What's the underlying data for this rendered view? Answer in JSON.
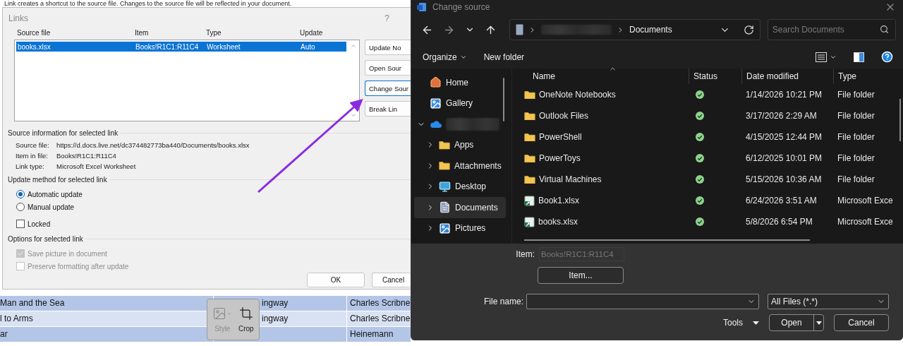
{
  "document": {
    "top_text": "Link creates a shortcut to the source file. Changes to the source file will be reflected in your document.",
    "table_rows": [
      {
        "cells": [
          "Man and the Sea",
          "ingway",
          "Charles Scribne"
        ]
      },
      {
        "cells": [
          "l to Arms",
          "ingway",
          "Charles Scribne"
        ]
      },
      {
        "cells": [
          "ar",
          null,
          "Heinemann"
        ]
      }
    ]
  },
  "links_dialog": {
    "title": "Links",
    "help": "?",
    "columns": [
      "Source file",
      "Item",
      "Type",
      "Update"
    ],
    "rows": [
      {
        "cells": [
          "books.xlsx",
          "Books!R1C1:R11C4",
          "Worksheet",
          "Auto"
        ],
        "selected": true
      }
    ],
    "side_buttons": [
      {
        "label": "Update No",
        "focused": false
      },
      {
        "label": "Open Sour",
        "focused": false
      },
      {
        "label": "Change Sour",
        "focused": true
      },
      {
        "label": "Break Lin",
        "focused": false
      }
    ],
    "source_info": {
      "heading": "Source information for selected link",
      "fields": [
        {
          "label": "Source file:",
          "value": "https://d.docs.live.net/dc374482773ba440/Documents/books.xlsx"
        },
        {
          "label": "Item in file:",
          "value": "Books!R1C1:R11C4"
        },
        {
          "label": "Link type:",
          "value": "Microsoft Excel Worksheet"
        }
      ]
    },
    "update_method": {
      "heading": "Update method for selected link",
      "options": [
        {
          "label": "Automatic update",
          "selected": true
        },
        {
          "label": "Manual update",
          "selected": false
        }
      ],
      "locked": {
        "label": "Locked",
        "checked": false
      }
    },
    "options": {
      "heading": "Options for selected link",
      "items": [
        {
          "label": "Save picture in document",
          "checked": true,
          "disabled": true
        },
        {
          "label": "Preserve formatting after update",
          "checked": false,
          "disabled": true
        }
      ]
    },
    "footer_buttons": [
      "OK",
      "Cancel"
    ]
  },
  "picture_toolbar": {
    "items": [
      {
        "label": "Style",
        "kind": "style",
        "disabled": true
      },
      {
        "label": "Crop",
        "kind": "crop",
        "disabled": false
      }
    ]
  },
  "change_source_dialog": {
    "title": "Change source",
    "nav": [
      {
        "kind": "back",
        "disabled": false
      },
      {
        "kind": "forward",
        "disabled": true
      },
      {
        "kind": "recent",
        "disabled": false
      },
      {
        "kind": "up",
        "disabled": false
      }
    ],
    "location": "Documents",
    "search": {
      "placeholder": "Search Documents"
    },
    "toolbar": {
      "organize": "Organize",
      "new_folder": "New folder"
    },
    "sidebar": {
      "items": [
        {
          "label": "Home",
          "kind": "home",
          "selected": false
        },
        {
          "label": "Gallery",
          "kind": "gallery",
          "selected": false
        },
        {
          "kind": "cloud",
          "expanded": true,
          "selected": false,
          "children": [
            {
              "label": "Apps",
              "kind": "folder",
              "expanded": false,
              "selected": false
            },
            {
              "label": "Attachments",
              "kind": "folder",
              "expanded": false,
              "selected": false
            },
            {
              "label": "Desktop",
              "kind": "desktop",
              "expanded": false,
              "selected": false
            },
            {
              "label": "Documents",
              "kind": "documents",
              "expanded": false,
              "selected": true
            },
            {
              "label": "Pictures",
              "kind": "pictures",
              "expanded": false,
              "selected": false
            }
          ]
        }
      ]
    },
    "columns": [
      "Name",
      "Status",
      "Date modified",
      "Type"
    ],
    "files": [
      {
        "name": "OneNote Notebooks",
        "kind": "folder",
        "date": "1/14/2026 10:21 PM",
        "type": "File folder"
      },
      {
        "name": "Outlook Files",
        "kind": "folder",
        "date": "3/17/2026 2:29 AM",
        "type": "File folder"
      },
      {
        "name": "PowerShell",
        "kind": "folder",
        "date": "4/15/2025 12:44 PM",
        "type": "File folder"
      },
      {
        "name": "PowerToys",
        "kind": "folder",
        "date": "6/12/2025 10:01 PM",
        "type": "File folder"
      },
      {
        "name": "Virtual Machines",
        "kind": "folder",
        "date": "5/15/2026 10:36 AM",
        "type": "File folder"
      },
      {
        "name": "Book1.xlsx",
        "kind": "excel",
        "date": "6/24/2026 3:51 AM",
        "type": "Microsoft Exce"
      },
      {
        "name": "books.xlsx",
        "kind": "excel",
        "date": "5/8/2026 6:54 PM",
        "type": "Microsoft Exce"
      }
    ],
    "item_label": "Item:",
    "item_value": "Books!R1C1:R11C4",
    "item_button": "Item...",
    "file_name_label": "File name:",
    "file_type": "All Files (*.*)",
    "tools": "Tools",
    "open": "Open",
    "cancel": "Cancel"
  }
}
